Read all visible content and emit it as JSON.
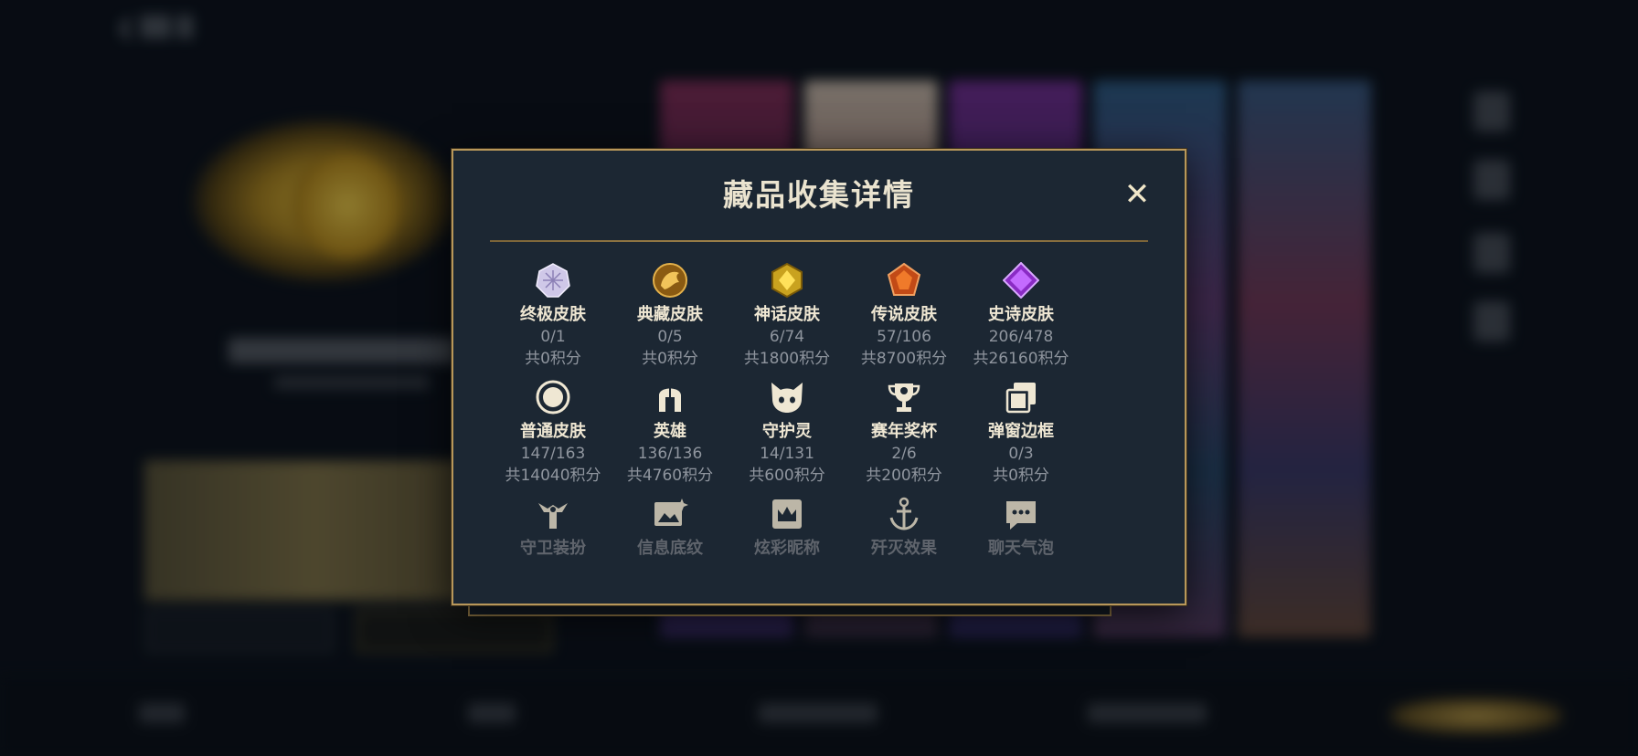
{
  "modal": {
    "title": "藏品收集详情",
    "close_label": "✕"
  },
  "items": [
    {
      "name": "终极皮肤",
      "count": "0/1",
      "points": "共0积分",
      "icon": "ultimate-skin-icon"
    },
    {
      "name": "典藏皮肤",
      "count": "0/5",
      "points": "共0积分",
      "icon": "collection-skin-icon"
    },
    {
      "name": "神话皮肤",
      "count": "6/74",
      "points": "共1800积分",
      "icon": "mythic-skin-icon"
    },
    {
      "name": "传说皮肤",
      "count": "57/106",
      "points": "共8700积分",
      "icon": "legendary-skin-icon"
    },
    {
      "name": "史诗皮肤",
      "count": "206/478",
      "points": "共26160积分",
      "icon": "epic-skin-icon"
    },
    {
      "name": "普通皮肤",
      "count": "147/163",
      "points": "共14040积分",
      "icon": "normal-skin-icon"
    },
    {
      "name": "英雄",
      "count": "136/136",
      "points": "共4760积分",
      "icon": "hero-helmet-icon"
    },
    {
      "name": "守护灵",
      "count": "14/131",
      "points": "共600积分",
      "icon": "guardian-spirit-icon"
    },
    {
      "name": "赛年奖杯",
      "count": "2/6",
      "points": "共200积分",
      "icon": "trophy-icon"
    },
    {
      "name": "弹窗边框",
      "count": "0/3",
      "points": "共0积分",
      "icon": "popup-frame-icon"
    },
    {
      "name": "守卫装扮",
      "icon": "ward-skin-icon"
    },
    {
      "name": "信息底纹",
      "icon": "info-texture-icon"
    },
    {
      "name": "炫彩昵称",
      "icon": "colorful-nickname-icon"
    },
    {
      "name": "歼灭效果",
      "icon": "elimination-effect-icon"
    },
    {
      "name": "聊天气泡",
      "icon": "chat-bubble-icon"
    }
  ],
  "colors": {
    "modal_bg": "#1c2733",
    "modal_border": "#b8975a",
    "title": "#eae3cf",
    "muted": "#8f959e"
  }
}
